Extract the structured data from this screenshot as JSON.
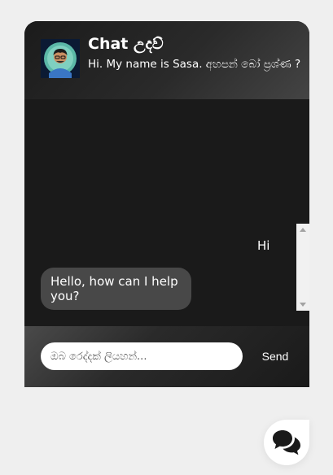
{
  "header": {
    "title": "Chat උදව්",
    "subtitle": "Hi. My name is Sasa. අහපන් බෝ ප්‍රශ්ණ ?",
    "avatar_icon": "user-avatar"
  },
  "messages": [
    {
      "from": "user",
      "text": "Hi"
    },
    {
      "from": "bot",
      "text": "Hello, how can I help you?"
    }
  ],
  "composer": {
    "placeholder": "ඔබ රෙද්දක් ලියහන්...",
    "value": "",
    "send_label": "Send"
  },
  "launcher": {
    "icon": "chat-bubbles-icon"
  },
  "colors": {
    "page_bg": "#efefef",
    "widget_bg": "#1a1a1a",
    "bot_bubble": "#484848",
    "text": "#ffffff"
  }
}
